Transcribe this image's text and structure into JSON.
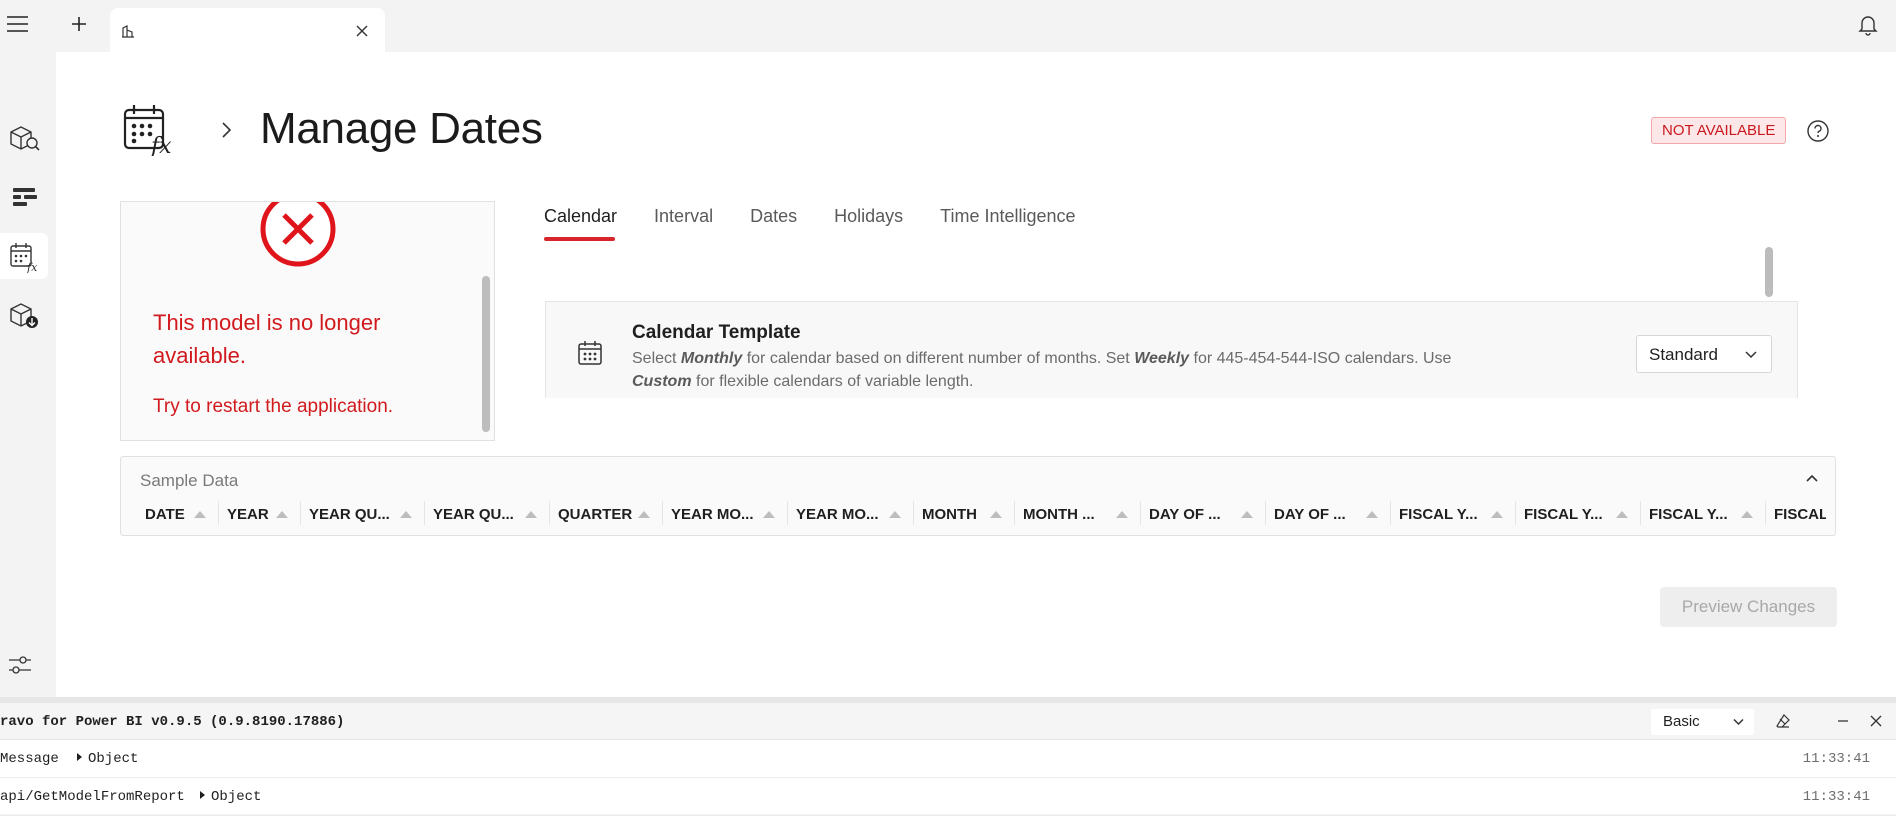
{
  "page": {
    "title": "Manage Dates",
    "status_badge": "NOT AVAILABLE"
  },
  "error": {
    "title": "This model is no longer available.",
    "subtitle": "Try to restart the application."
  },
  "tabs": [
    "Calendar",
    "Interval",
    "Dates",
    "Holidays",
    "Time Intelligence"
  ],
  "active_tab": "Calendar",
  "calendar_template": {
    "title": "Calendar Template",
    "desc_1": "Select ",
    "desc_monthly": "Monthly",
    "desc_2": " for calendar based on different number of months. Set ",
    "desc_weekly": "Weekly",
    "desc_3": " for 445-454-544-ISO calendars. Use",
    "desc_custom": "Custom",
    "desc_4": " for flexible calendars of variable length.",
    "selected": "Standard"
  },
  "sample_data": {
    "title": "Sample Data",
    "columns": [
      "DATE",
      "YEAR",
      "YEAR QU...",
      "YEAR QU...",
      "QUARTER",
      "YEAR MO...",
      "YEAR MO...",
      "MONTH",
      "MONTH ...",
      "DAY OF ...",
      "DAY OF ...",
      "FISCAL Y...",
      "FISCAL Y...",
      "FISCAL Y...",
      "FISCAL"
    ]
  },
  "buttons": {
    "preview": "Preview Changes"
  },
  "console": {
    "title": "ravo for Power BI v0.9.5 (0.9.8190.17886)",
    "level": "Basic",
    "rows": [
      {
        "message": "Message",
        "object": "Object",
        "time": "11:33:41"
      },
      {
        "message": "api/GetModelFromReport",
        "object": "Object",
        "time": "11:33:41"
      }
    ]
  },
  "colors": {
    "accent": "#d6262b",
    "error": "#d11a1e",
    "badge_bg": "#fde7e8"
  },
  "icons": [
    "menu-icon",
    "plus-icon",
    "tab-model-icon",
    "close-icon",
    "bell-icon",
    "model-search-icon",
    "format-icon",
    "calendar-fx-icon",
    "model-export-icon",
    "settings-sliders-icon",
    "chevron-right-icon",
    "help-icon",
    "error-x-icon",
    "calendar-icon",
    "chevron-down-icon",
    "chevron-up-icon",
    "eraser-icon",
    "minimize-icon"
  ]
}
